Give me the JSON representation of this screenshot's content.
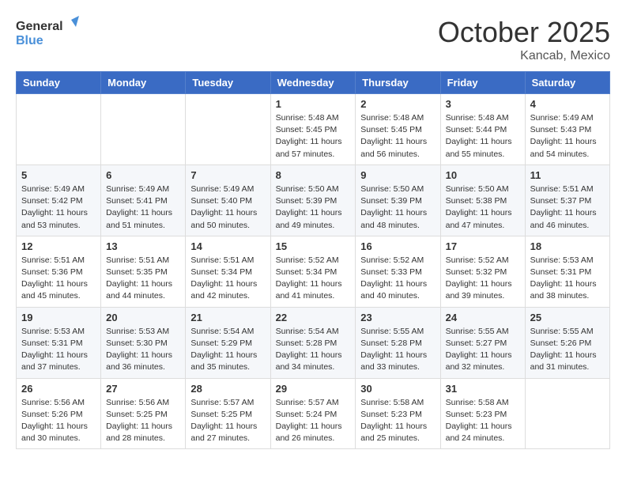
{
  "header": {
    "logo_general": "General",
    "logo_blue": "Blue",
    "month_title": "October 2025",
    "location": "Kancab, Mexico"
  },
  "weekdays": [
    "Sunday",
    "Monday",
    "Tuesday",
    "Wednesday",
    "Thursday",
    "Friday",
    "Saturday"
  ],
  "weeks": [
    [
      {
        "day": "",
        "info": ""
      },
      {
        "day": "",
        "info": ""
      },
      {
        "day": "",
        "info": ""
      },
      {
        "day": "1",
        "info": "Sunrise: 5:48 AM\nSunset: 5:45 PM\nDaylight: 11 hours\nand 57 minutes."
      },
      {
        "day": "2",
        "info": "Sunrise: 5:48 AM\nSunset: 5:45 PM\nDaylight: 11 hours\nand 56 minutes."
      },
      {
        "day": "3",
        "info": "Sunrise: 5:48 AM\nSunset: 5:44 PM\nDaylight: 11 hours\nand 55 minutes."
      },
      {
        "day": "4",
        "info": "Sunrise: 5:49 AM\nSunset: 5:43 PM\nDaylight: 11 hours\nand 54 minutes."
      }
    ],
    [
      {
        "day": "5",
        "info": "Sunrise: 5:49 AM\nSunset: 5:42 PM\nDaylight: 11 hours\nand 53 minutes."
      },
      {
        "day": "6",
        "info": "Sunrise: 5:49 AM\nSunset: 5:41 PM\nDaylight: 11 hours\nand 51 minutes."
      },
      {
        "day": "7",
        "info": "Sunrise: 5:49 AM\nSunset: 5:40 PM\nDaylight: 11 hours\nand 50 minutes."
      },
      {
        "day": "8",
        "info": "Sunrise: 5:50 AM\nSunset: 5:39 PM\nDaylight: 11 hours\nand 49 minutes."
      },
      {
        "day": "9",
        "info": "Sunrise: 5:50 AM\nSunset: 5:39 PM\nDaylight: 11 hours\nand 48 minutes."
      },
      {
        "day": "10",
        "info": "Sunrise: 5:50 AM\nSunset: 5:38 PM\nDaylight: 11 hours\nand 47 minutes."
      },
      {
        "day": "11",
        "info": "Sunrise: 5:51 AM\nSunset: 5:37 PM\nDaylight: 11 hours\nand 46 minutes."
      }
    ],
    [
      {
        "day": "12",
        "info": "Sunrise: 5:51 AM\nSunset: 5:36 PM\nDaylight: 11 hours\nand 45 minutes."
      },
      {
        "day": "13",
        "info": "Sunrise: 5:51 AM\nSunset: 5:35 PM\nDaylight: 11 hours\nand 44 minutes."
      },
      {
        "day": "14",
        "info": "Sunrise: 5:51 AM\nSunset: 5:34 PM\nDaylight: 11 hours\nand 42 minutes."
      },
      {
        "day": "15",
        "info": "Sunrise: 5:52 AM\nSunset: 5:34 PM\nDaylight: 11 hours\nand 41 minutes."
      },
      {
        "day": "16",
        "info": "Sunrise: 5:52 AM\nSunset: 5:33 PM\nDaylight: 11 hours\nand 40 minutes."
      },
      {
        "day": "17",
        "info": "Sunrise: 5:52 AM\nSunset: 5:32 PM\nDaylight: 11 hours\nand 39 minutes."
      },
      {
        "day": "18",
        "info": "Sunrise: 5:53 AM\nSunset: 5:31 PM\nDaylight: 11 hours\nand 38 minutes."
      }
    ],
    [
      {
        "day": "19",
        "info": "Sunrise: 5:53 AM\nSunset: 5:31 PM\nDaylight: 11 hours\nand 37 minutes."
      },
      {
        "day": "20",
        "info": "Sunrise: 5:53 AM\nSunset: 5:30 PM\nDaylight: 11 hours\nand 36 minutes."
      },
      {
        "day": "21",
        "info": "Sunrise: 5:54 AM\nSunset: 5:29 PM\nDaylight: 11 hours\nand 35 minutes."
      },
      {
        "day": "22",
        "info": "Sunrise: 5:54 AM\nSunset: 5:28 PM\nDaylight: 11 hours\nand 34 minutes."
      },
      {
        "day": "23",
        "info": "Sunrise: 5:55 AM\nSunset: 5:28 PM\nDaylight: 11 hours\nand 33 minutes."
      },
      {
        "day": "24",
        "info": "Sunrise: 5:55 AM\nSunset: 5:27 PM\nDaylight: 11 hours\nand 32 minutes."
      },
      {
        "day": "25",
        "info": "Sunrise: 5:55 AM\nSunset: 5:26 PM\nDaylight: 11 hours\nand 31 minutes."
      }
    ],
    [
      {
        "day": "26",
        "info": "Sunrise: 5:56 AM\nSunset: 5:26 PM\nDaylight: 11 hours\nand 30 minutes."
      },
      {
        "day": "27",
        "info": "Sunrise: 5:56 AM\nSunset: 5:25 PM\nDaylight: 11 hours\nand 28 minutes."
      },
      {
        "day": "28",
        "info": "Sunrise: 5:57 AM\nSunset: 5:25 PM\nDaylight: 11 hours\nand 27 minutes."
      },
      {
        "day": "29",
        "info": "Sunrise: 5:57 AM\nSunset: 5:24 PM\nDaylight: 11 hours\nand 26 minutes."
      },
      {
        "day": "30",
        "info": "Sunrise: 5:58 AM\nSunset: 5:23 PM\nDaylight: 11 hours\nand 25 minutes."
      },
      {
        "day": "31",
        "info": "Sunrise: 5:58 AM\nSunset: 5:23 PM\nDaylight: 11 hours\nand 24 minutes."
      },
      {
        "day": "",
        "info": ""
      }
    ]
  ]
}
